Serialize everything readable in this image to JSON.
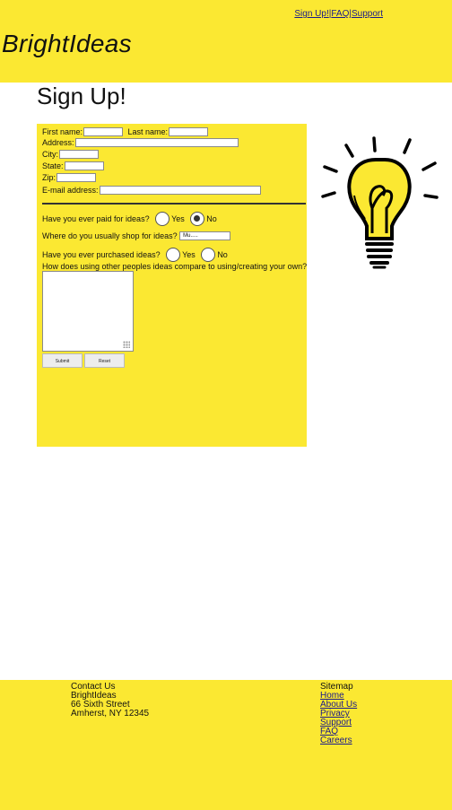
{
  "header": {
    "nav": {
      "signup": "Sign Up!",
      "sep": "|",
      "faq": "FAQ",
      "support": "Support"
    },
    "brand": "BrightIdeas"
  },
  "page": {
    "title": "Sign Up!"
  },
  "form": {
    "first_name_label": "First name:",
    "last_name_label": "Last name:",
    "address_label": "Address:",
    "city_label": "City:",
    "state_label": "State:",
    "zip_label": "Zip:",
    "email_label": "E-mail address:",
    "q_paid": "Have you ever paid for ideas?",
    "q_shop": "Where do you usually shop for ideas?",
    "shop_selected": "Mu.....",
    "q_purchased": "Have you ever purchased ideas?",
    "q_compare": "How does using other peoples ideas compare to using/creating your own?",
    "yes": "Yes",
    "no": "No",
    "paid_selected": "No",
    "purchased_selected": "",
    "submit_label": "Submit",
    "reset_label": "Reset"
  },
  "footer": {
    "contact": [
      "Contact Us",
      "BrightIdeas",
      "66 Sixth Street",
      "Amherst, NY 12345"
    ],
    "sitemap_title": "Sitemap",
    "sitemap_links": [
      "Home",
      "About Us",
      "Privacy",
      "Support",
      "FAQ",
      "Careers"
    ]
  },
  "colors": {
    "accent_yellow": "#fbe832",
    "link": "#1a1a8a"
  },
  "icons": {
    "bulb": "lightbulb-icon"
  }
}
